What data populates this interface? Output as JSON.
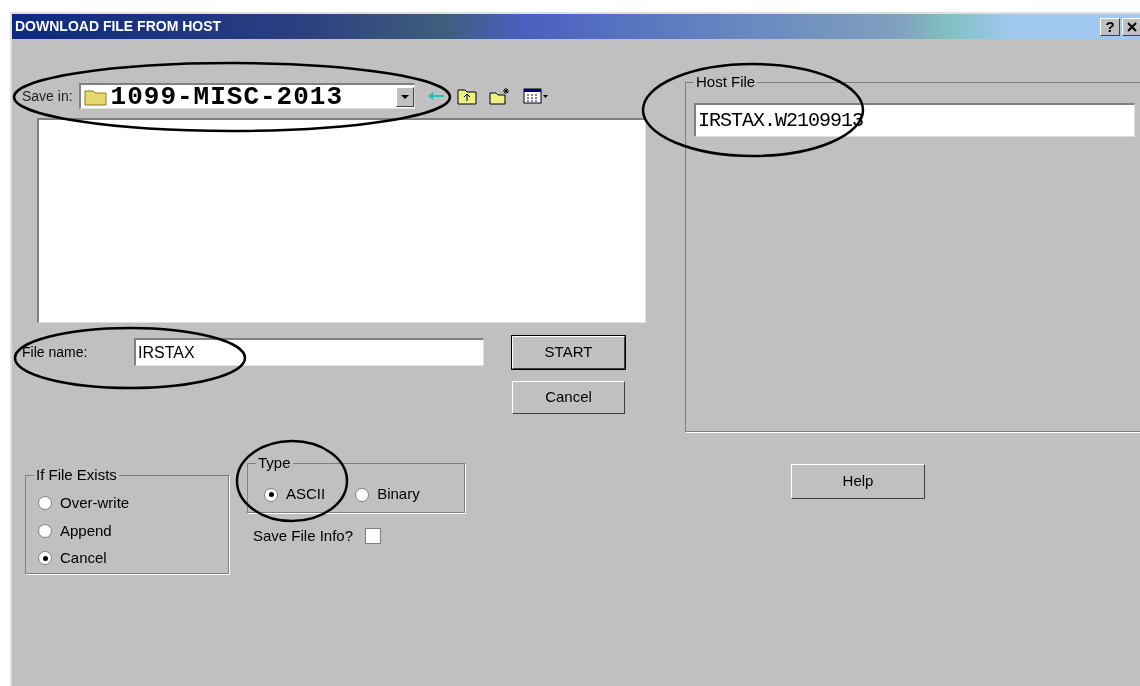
{
  "window": {
    "title": "DOWNLOAD FILE FROM HOST",
    "help_button": "?"
  },
  "save_in": {
    "label": "Save in:",
    "value": "1099-MISC-2013"
  },
  "file_name": {
    "label": "File name:",
    "value": "IRSTAX"
  },
  "buttons": [
    {
      "label": "START",
      "default": true
    },
    {
      "label": "Cancel",
      "default": false
    }
  ],
  "host_file": {
    "title": "Host File",
    "value": "IRSTAX.W2109913"
  },
  "if_file_exists": {
    "title": "If File Exists",
    "options": [
      {
        "label": "Over-write",
        "selected": false
      },
      {
        "label": "Append",
        "selected": false
      },
      {
        "label": "Cancel",
        "selected": true
      }
    ]
  },
  "type": {
    "title": "Type",
    "options": [
      {
        "label": "ASCII",
        "selected": true
      },
      {
        "label": "Binary",
        "selected": false
      }
    ]
  },
  "save_file_info": {
    "label": "Save File Info?",
    "checked": false
  },
  "help": {
    "label": "Help"
  }
}
